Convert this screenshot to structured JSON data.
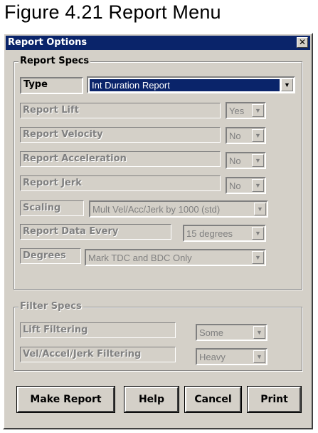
{
  "figure_title": "Figure 4.21  Report Menu",
  "dialog": {
    "title": "Report Options",
    "close_glyph": "✕",
    "report_specs": {
      "legend": "Report Specs",
      "type_label": "Type",
      "type_value": "Int Duration Report",
      "rows": [
        {
          "label": "Report Lift",
          "value": "Yes"
        },
        {
          "label": "Report Velocity",
          "value": "No"
        },
        {
          "label": "Report Acceleration",
          "value": "No"
        },
        {
          "label": "Report Jerk",
          "value": "No"
        },
        {
          "label": "Scaling",
          "value": "Mult Vel/Acc/Jerk by 1000 (std)"
        },
        {
          "label": "Report Data Every",
          "value": "15 degrees"
        },
        {
          "label": "Degrees",
          "value": "Mark TDC and BDC Only"
        }
      ]
    },
    "filter_specs": {
      "legend": "Filter Specs",
      "rows": [
        {
          "label": "Lift Filtering",
          "value": "Some"
        },
        {
          "label": "Vel/Accel/Jerk Filtering",
          "value": "Heavy"
        }
      ]
    },
    "buttons": {
      "make_report": "Make Report",
      "help": "Help",
      "cancel": "Cancel",
      "print": "Print"
    },
    "dropdown_arrow": "▼"
  }
}
